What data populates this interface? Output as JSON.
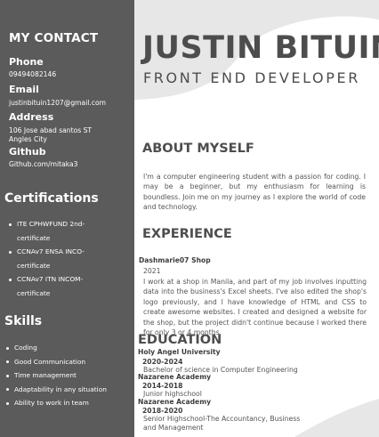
{
  "sidebar": {
    "contact_title": "MY CONTACT",
    "phone_label": "Phone",
    "phone": "09494082146",
    "email_label": "Email",
    "email": "justinbituin1207@gmail.com",
    "address_label": "Address",
    "address_line1": "106 Jose abad santos ST",
    "address_line2": "Angles City",
    "github_label": "Github",
    "github": "Github.com/mitaka3",
    "certifications_title": "Certifications",
    "certifications": [
      "ITE CPHWFUND 2nd-",
      "certificate",
      "CCNAv7 ENSA INCO-",
      "certificate",
      "CCNAv7 ITN INCOM-",
      "certificate"
    ],
    "skills_title": "Skills",
    "skills": [
      "Coding",
      "Good Communication",
      "Time management",
      "Adaptability in any situation",
      "Ability to work in team"
    ]
  },
  "header": {
    "name": "JUSTIN BITUIN",
    "role": "FRONT END DEVELOPER"
  },
  "about": {
    "title": "ABOUT MYSELF",
    "text": "I'm a computer engineering student with a passion for coding. I may be a beginner, but my enthusiasm for learning is boundless. Join me on my journey as I explore the world of code and technology."
  },
  "experience": {
    "title": "EXPERIENCE",
    "company": "Dashmarie07 Shop",
    "year": "2021",
    "text": "I work at a shop in Manila, and part of my job involves inputting data into the business's Excel sheets. I've also edited the shop's logo previously, and I have knowledge of HTML and CSS to create awesome websites. I created and designed a website for the shop, but the project didn't continue because I worked there for only 3 or 4 months."
  },
  "education": {
    "title": "EDUCATION",
    "entries": [
      {
        "school": "Holy Angel University",
        "years": "2020-2024",
        "detail": "Bachelor of science in Computer Engineering"
      },
      {
        "school": "Nazarene Academy",
        "years": "2014-2018",
        "detail": "Junior highschool"
      },
      {
        "school": "Nazarene Academy",
        "years": "2018-2020",
        "detail": "Senior Highschool-The Accountancy, Business",
        "detail2": "and Management"
      }
    ]
  },
  "colors": {
    "sidebar": "#5b5b5b",
    "decor_shape": "#e7e7e7",
    "heading": "#4d4d4d"
  }
}
